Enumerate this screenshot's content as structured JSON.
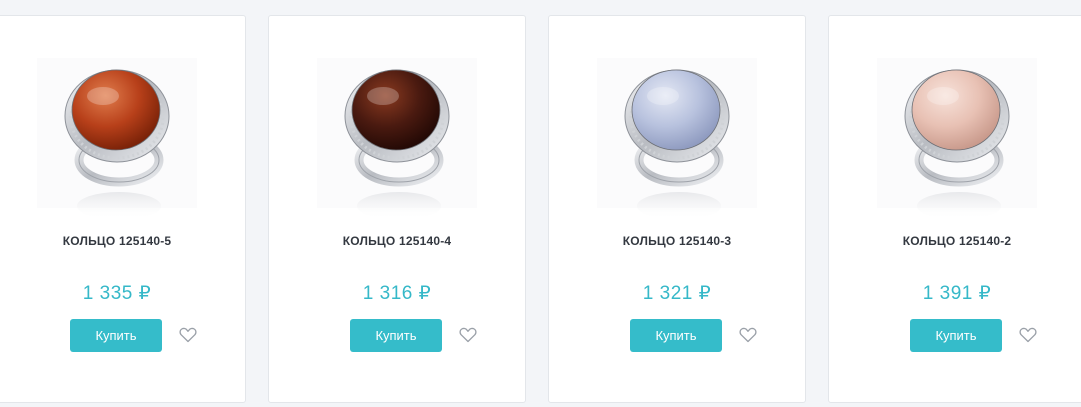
{
  "products": [
    {
      "title": "КОЛЬЦО 125140-5",
      "price": "1 335 ₽",
      "buy_label": "Купить",
      "stone_color": "#b8401a",
      "stone_shade": "#7a2208",
      "stone_highlight": "#e07d4d",
      "fav_icon": "heart-outline-icon"
    },
    {
      "title": "КОЛЬЦО 125140-4",
      "price": "1 316 ₽",
      "buy_label": "Купить",
      "stone_color": "#4a1a10",
      "stone_shade": "#230905",
      "stone_highlight": "#8a3a20",
      "fav_icon": "heart-outline-icon"
    },
    {
      "title": "КОЛЬЦО 125140-3",
      "price": "1 321 ₽",
      "buy_label": "Купить",
      "stone_color": "#b8c2de",
      "stone_shade": "#8f9bc0",
      "stone_highlight": "#e4e8f4",
      "fav_icon": "heart-outline-icon"
    },
    {
      "title": "КОЛЬЦО 125140-2",
      "price": "1 391 ₽",
      "buy_label": "Купить",
      "stone_color": "#e8c1b4",
      "stone_shade": "#c99a8c",
      "stone_highlight": "#f7e2da",
      "fav_icon": "heart-outline-icon"
    }
  ],
  "colors": {
    "accent": "#35bcca",
    "price": "#35b8c8",
    "background": "#f3f5f8"
  }
}
